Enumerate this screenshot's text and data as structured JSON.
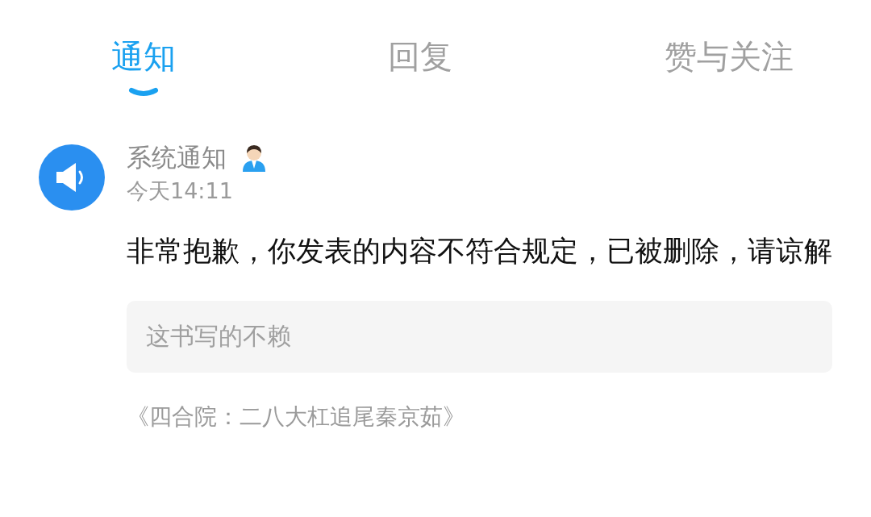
{
  "tabs": [
    {
      "label": "通知",
      "selected": true
    },
    {
      "label": "回复",
      "selected": false
    },
    {
      "label": "赞与关注",
      "selected": false
    }
  ],
  "notification": {
    "sender": "系统通知",
    "time": "今天14:11",
    "message": "非常抱歉，你发表的内容不符合规定，已被删除，请谅解",
    "quote": "这书写的不赖",
    "source": "《四合院：二八大杠追尾秦京茹》"
  }
}
